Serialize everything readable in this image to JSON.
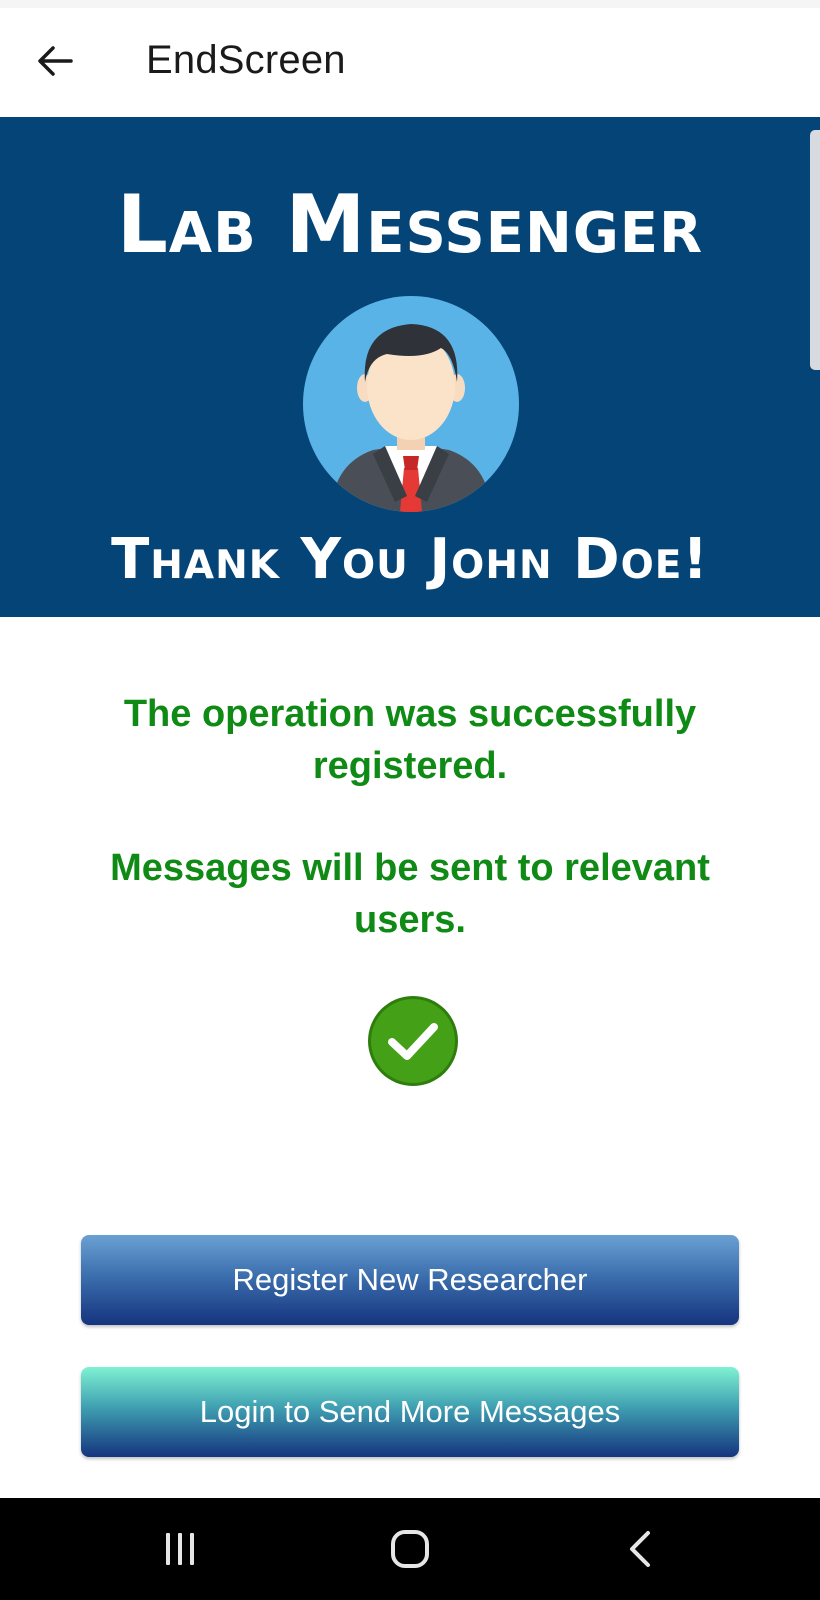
{
  "app_bar": {
    "title": "EndScreen",
    "back_icon": "arrow-left-icon"
  },
  "banner": {
    "brand": "Lab Messenger",
    "avatar_icon": "businessman-avatar-icon",
    "thanks": "Thank You John Doe!",
    "background_color": "#054477"
  },
  "messages": {
    "line1": "The operation was successfully registered.",
    "line2": "Messages will be sent to relevant users.",
    "color": "#0f8a15",
    "status_icon": "check-circle-icon"
  },
  "buttons": {
    "register_label": "Register New Researcher",
    "login_label": "Login to Send More Messages"
  },
  "system_nav": {
    "recent_icon": "recent-apps-icon",
    "home_icon": "home-icon",
    "back_icon": "back-chevron-icon"
  }
}
